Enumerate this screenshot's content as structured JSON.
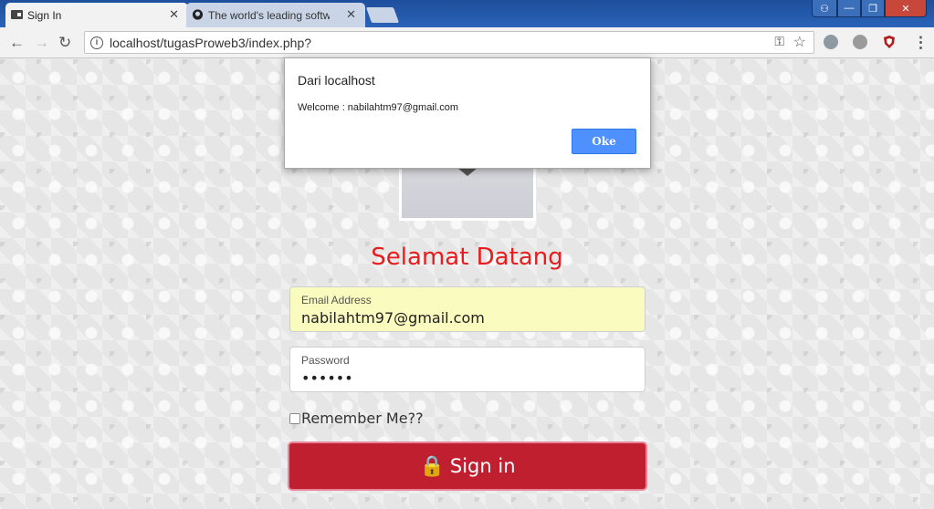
{
  "browser": {
    "tabs": [
      {
        "label": "Sign In",
        "close": "✕"
      },
      {
        "label": "The world's leading software",
        "close": "✕"
      }
    ],
    "url": "localhost/tugasProweb3/index.php?",
    "nav": {
      "back": "←",
      "forward": "→",
      "reload": "↻"
    },
    "omnibox_icons": {
      "info": "i",
      "key": "⚿",
      "star": "☆"
    },
    "window_controls": {
      "user": "⚇",
      "minimize": "—",
      "maximize": "❐",
      "close": "✕"
    },
    "menu": "⋮"
  },
  "page": {
    "heading": "Selamat Datang",
    "email": {
      "label": "Email Address",
      "value": "nabilahtm97@gmail.com"
    },
    "password": {
      "label": "Password",
      "value": "••••••"
    },
    "remember_label": "Remember Me??",
    "signin_label": "Sign in",
    "signin_icon": "🔒"
  },
  "alert": {
    "title": "Dari localhost",
    "message": "Welcome : nabilahtm97@gmail.com",
    "ok_label": "Oke"
  },
  "colors": {
    "heading": "#e81c1c",
    "signin_bg": "#c01f2f",
    "email_bg": "#f9fbbf",
    "ok_button": "#4d90fe"
  }
}
